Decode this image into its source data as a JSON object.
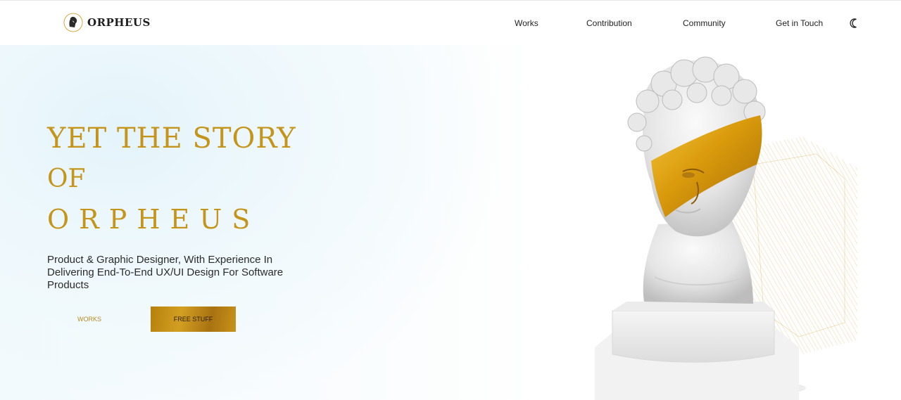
{
  "brand": {
    "name": "ORPHEUS"
  },
  "nav": {
    "items": [
      {
        "label": "Works"
      },
      {
        "label": "Contribution"
      },
      {
        "label": "Community"
      },
      {
        "label": "Get in Touch"
      }
    ],
    "theme_icon": "moon-icon"
  },
  "hero": {
    "headline_line1": "YET THE STORY",
    "headline_line2": "OF",
    "headline_line3": "ORPHEUS",
    "subtitle": "Product & Graphic Designer, With Experience In Delivering End-To-End UX/UI Design For Software Products",
    "buttons": {
      "works": "WORKS",
      "free_stuff": "FREE STUFF"
    },
    "image": "david-bust-gold-mask"
  },
  "colors": {
    "accent_gold": "#c4951a",
    "text_dark": "#222222",
    "hero_tint": "#e4f4fb"
  }
}
